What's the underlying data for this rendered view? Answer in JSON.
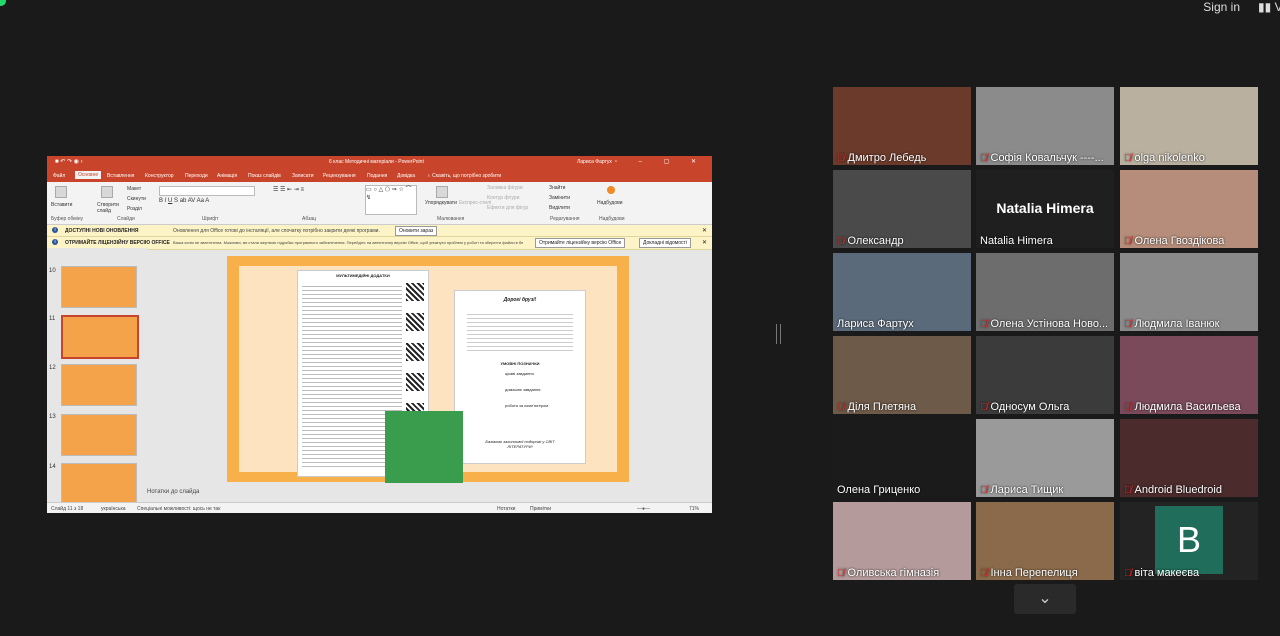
{
  "top": {
    "sign_in": "Sign in",
    "view": "V"
  },
  "ppt": {
    "title": "6 клас Методичні матеріали  -  PowerPoint",
    "user": "Лариса Фартух",
    "tabs": [
      "Файл",
      "Основне",
      "Вставлення",
      "Конструктор",
      "Переходи",
      "Анімація",
      "Показ слайдів",
      "Записати",
      "Рецензування",
      "Подання",
      "Довідка",
      "Скажіть, що потрібно зробити"
    ],
    "ribbon": {
      "paste": "Вставити",
      "clipboard": "Буфер обміну",
      "new_slide": "Створити слайд",
      "layout": "Макет",
      "reset": "Скинути",
      "section": "Розділ",
      "slides": "Слайди",
      "font": "Шрифт",
      "paragraph": "Абзац",
      "drawing": "Малювання",
      "arrange": "Упорядкувати",
      "quick_styles": "Експрес-стилі",
      "shape_fill": "Заливка фігури",
      "shape_outline": "Контур фігури",
      "shape_effects": "Ефекти для фігур",
      "find": "Знайти",
      "replace": "Замінити",
      "select": "Виділити",
      "editing": "Редагування",
      "addins": "Надбудови"
    },
    "bar1": {
      "bold": "ДОСТУПНІ НОВІ ОНОВЛЕННЯ",
      "msg": "Оновлення для Office готові до інсталяції, але спочатку потрібно закрити деякі програми.",
      "button": "Оновити зараз"
    },
    "bar2": {
      "bold": "ОТРИМАЙТЕ ЛІЦЕНЗІЙНУ ВЕРСІЮ OFFICE",
      "msg": "Ваша копія не автентична. Можливо, ви стали жертвою підробки програмного забезпечення. Перейдіть на автентичну версію Office, щоб уникнути проблем у роботі та зберегти файли в безпеці.",
      "button1": "Отримайте ліцензійну версію Office",
      "button2": "Докладні відомості"
    },
    "thumb_numbers": [
      "10",
      "11",
      "12",
      "13",
      "14"
    ],
    "slide_left_title": "МУЛЬТИМЕДІЙНІ ДОДАТКИ",
    "slide_right_title": "Дорогі друзі!",
    "slide_right_heading": "УМОВНІ ПОЗНАЧКИ",
    "slide_right_items": [
      "цікаві завдання",
      "домашнє завдання",
      "робота за комп'ютером"
    ],
    "slide_right_footer": "Бажаємо захопливої подорожі у СВІТ ЛІТЕРАТУРИ!",
    "notes": "Нотатки до слайда",
    "status": {
      "slide": "Слайд 11 з 18",
      "lang": "українська",
      "access": "Спеціальні можливості: щось не так",
      "notes": "Нотатки",
      "comments": "Примітки",
      "zoom": "71%"
    }
  },
  "participants": [
    {
      "name": "Дмитро Лебедь",
      "muted": true
    },
    {
      "name": "Софія Ковальчук ----...",
      "muted": true
    },
    {
      "name": "olga nikolenko",
      "muted": true
    },
    {
      "name": "Олександр",
      "muted": true
    },
    {
      "name": "Natalia Himera",
      "muted": false,
      "big_name": "Natalia Himera"
    },
    {
      "name": "Олена Гвоздікова",
      "muted": true
    },
    {
      "name": "Лариса Фартух",
      "muted": false
    },
    {
      "name": "Олена Устінова Ново...",
      "muted": true
    },
    {
      "name": "Людмила Іванюк",
      "muted": true
    },
    {
      "name": "Діля Плетяна",
      "muted": true
    },
    {
      "name": "Односум Ольга",
      "muted": true
    },
    {
      "name": "Людмила Васильева",
      "muted": true
    },
    {
      "name": "Олена Гриценко",
      "muted": false
    },
    {
      "name": "Лариса Тищик",
      "muted": true
    },
    {
      "name": "Android Bluedroid",
      "muted": true
    },
    {
      "name": "Оливська гімназія",
      "muted": true
    },
    {
      "name": "Інна Перепелиця",
      "muted": true
    },
    {
      "name": "віта макеєва",
      "muted": true,
      "avatar_letter": "B"
    }
  ],
  "colors": {
    "accent": "#c8452b",
    "active_speaker": "#c9e34c",
    "muted": "#e02b2b"
  }
}
